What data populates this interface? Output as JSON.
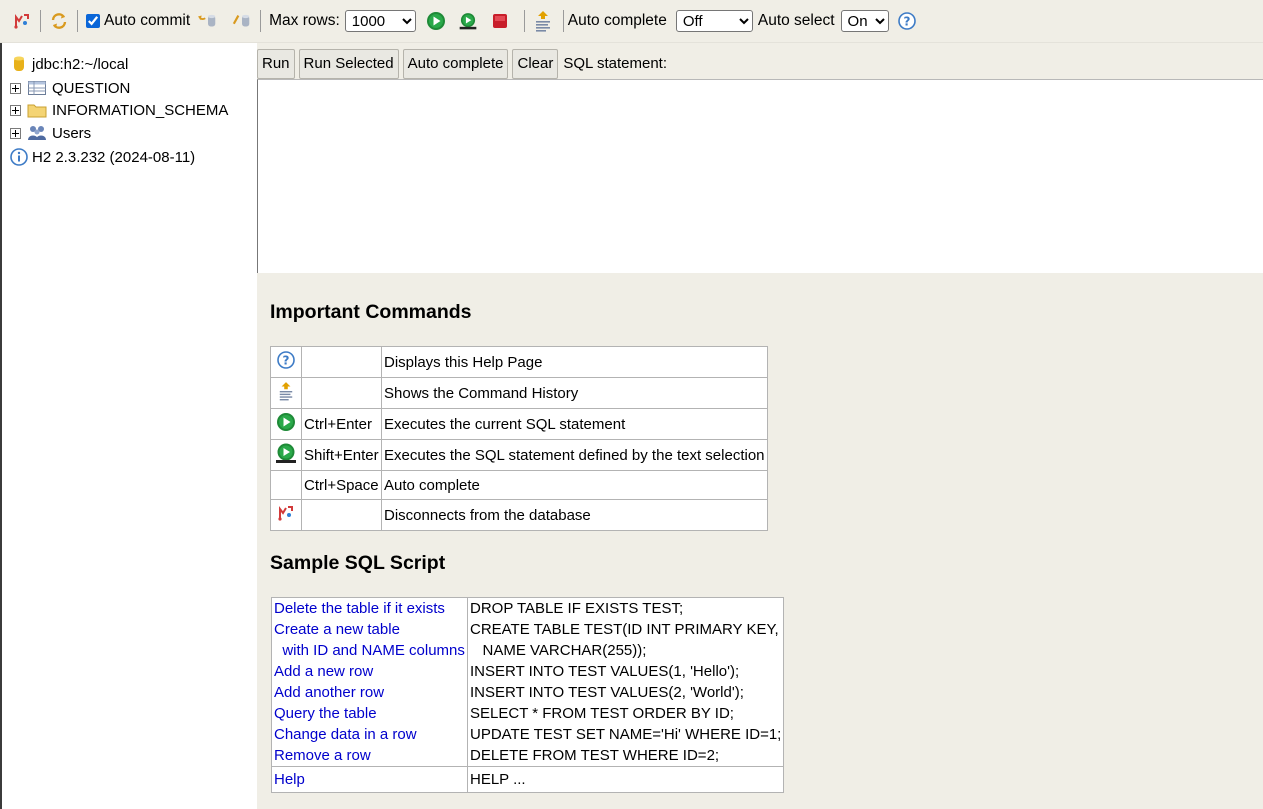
{
  "toolbar": {
    "auto_commit_label": "Auto commit",
    "auto_commit_checked": true,
    "max_rows_label": "Max rows:",
    "max_rows_value": "1000",
    "auto_complete_label": "Auto complete",
    "auto_complete_value": "Off",
    "auto_select_label": "Auto select",
    "auto_select_value": "On"
  },
  "tree": {
    "connection": "jdbc:h2:~/local",
    "items": [
      {
        "label": "QUESTION",
        "icon": "table-icon"
      },
      {
        "label": "INFORMATION_SCHEMA",
        "icon": "folder-icon"
      },
      {
        "label": "Users",
        "icon": "users-icon"
      }
    ],
    "version": "H2 2.3.232 (2024-08-11)"
  },
  "commands": {
    "run": "Run",
    "run_selected": "Run Selected",
    "auto_complete": "Auto complete",
    "clear": "Clear",
    "sql_label": "SQL statement:"
  },
  "help": {
    "important_title": "Important Commands",
    "rows": [
      {
        "icon": "help-icon",
        "key": "",
        "desc": "Displays this Help Page"
      },
      {
        "icon": "history-icon",
        "key": "",
        "desc": "Shows the Command History"
      },
      {
        "icon": "run-icon",
        "key": "Ctrl+Enter",
        "desc": "Executes the current SQL statement"
      },
      {
        "icon": "run-selected-icon",
        "key": "Shift+Enter",
        "desc": "Executes the SQL statement defined by the text selection"
      },
      {
        "icon": "",
        "key": "Ctrl+Space",
        "desc": "Auto complete"
      },
      {
        "icon": "disconnect-icon",
        "key": "",
        "desc": "Disconnects from the database"
      }
    ],
    "sample_title": "Sample SQL Script",
    "sample": [
      {
        "links": [
          "Delete the table if it exists"
        ],
        "sql": [
          "DROP TABLE IF EXISTS TEST;"
        ]
      },
      {
        "links": [
          "Create a new table",
          "  with ID and NAME columns"
        ],
        "sql": [
          "CREATE TABLE TEST(ID INT PRIMARY KEY,",
          "   NAME VARCHAR(255));"
        ]
      },
      {
        "links": [
          "Add a new row"
        ],
        "sql": [
          "INSERT INTO TEST VALUES(1, 'Hello');"
        ]
      },
      {
        "links": [
          "Add another row"
        ],
        "sql": [
          "INSERT INTO TEST VALUES(2, 'World');"
        ]
      },
      {
        "links": [
          "Query the table"
        ],
        "sql": [
          "SELECT * FROM TEST ORDER BY ID;"
        ]
      },
      {
        "links": [
          "Change data in a row"
        ],
        "sql": [
          "UPDATE TEST SET NAME='Hi' WHERE ID=1;"
        ]
      },
      {
        "links": [
          "Remove a row"
        ],
        "sql": [
          "DELETE FROM TEST WHERE ID=2;"
        ]
      }
    ],
    "help_link": "Help",
    "help_sql": "HELP ..."
  }
}
